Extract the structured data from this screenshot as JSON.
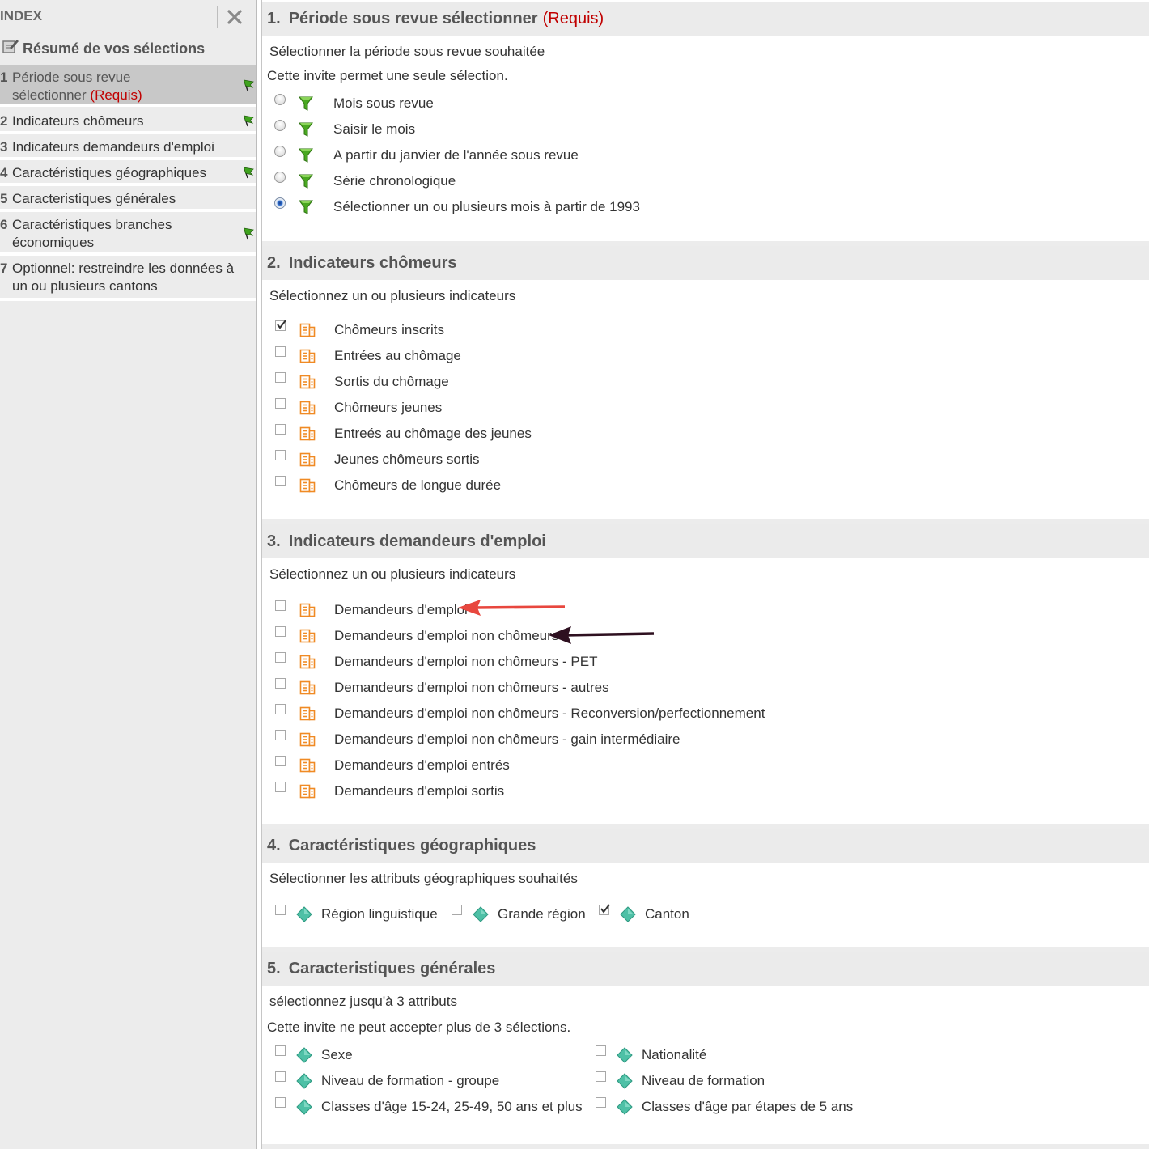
{
  "sidebar": {
    "title": "INDEX",
    "summary_label": "Résumé de vos sélections",
    "items": [
      {
        "num": "1",
        "line1": "Période sous revue",
        "line2": "sélectionner",
        "required": "(Requis)"
      },
      {
        "num": "2",
        "label": "Indicateurs chômeurs"
      },
      {
        "num": "3",
        "label": "Indicateurs demandeurs d'emploi"
      },
      {
        "num": "4",
        "label": "Caractéristiques géographiques"
      },
      {
        "num": "5",
        "label": "Caracteristiques générales"
      },
      {
        "num": "6",
        "line1": "Caractéristiques branches",
        "line2": "économiques"
      },
      {
        "num": "7",
        "line1": "Optionnel: restreindre les données à",
        "line2": "un ou plusieurs cantons"
      }
    ]
  },
  "sections": {
    "s1": {
      "num": "1.",
      "title": "Période sous revue sélectionner",
      "required": "(Requis)",
      "instruction": "Sélectionner la période sous revue souhaitée",
      "note": "Cette invite permet une seule sélection.",
      "options": [
        {
          "label": "Mois sous revue",
          "checked": false
        },
        {
          "label": "Saisir le mois",
          "checked": false
        },
        {
          "label": "A partir du janvier de l'année sous revue",
          "checked": false
        },
        {
          "label": "Série chronologique",
          "checked": false
        },
        {
          "label": "Sélectionner un ou plusieurs mois à partir de 1993",
          "checked": true
        }
      ]
    },
    "s2": {
      "num": "2.",
      "title": "Indicateurs chômeurs",
      "instruction": "Sélectionnez un ou plusieurs indicateurs",
      "options": [
        {
          "label": "Chômeurs inscrits",
          "checked": true
        },
        {
          "label": "Entrées au chômage",
          "checked": false
        },
        {
          "label": "Sortis du chômage",
          "checked": false
        },
        {
          "label": "Chômeurs jeunes",
          "checked": false
        },
        {
          "label": "Entreés au chômage des jeunes",
          "checked": false
        },
        {
          "label": "Jeunes chômeurs sortis",
          "checked": false
        },
        {
          "label": "Chômeurs de longue durée",
          "checked": false
        }
      ]
    },
    "s3": {
      "num": "3.",
      "title": "Indicateurs demandeurs d'emploi",
      "instruction": "Sélectionnez un ou plusieurs indicateurs",
      "options": [
        {
          "label": "Demandeurs d'emploi",
          "checked": false
        },
        {
          "label": "Demandeurs d'emploi non chômeurs",
          "checked": false
        },
        {
          "label": "Demandeurs d'emploi non chômeurs - PET",
          "checked": false
        },
        {
          "label": "Demandeurs d'emploi non chômeurs - autres",
          "checked": false
        },
        {
          "label": "Demandeurs d'emploi non chômeurs - Reconversion/perfectionnement",
          "checked": false
        },
        {
          "label": "Demandeurs d'emploi non chômeurs - gain intermédiaire",
          "checked": false
        },
        {
          "label": "Demandeurs d'emploi entrés",
          "checked": false
        },
        {
          "label": "Demandeurs d'emploi sortis",
          "checked": false
        }
      ]
    },
    "s4": {
      "num": "4.",
      "title": "Caractéristiques géographiques",
      "instruction": "Sélectionner les attributs géographiques souhaités",
      "options": [
        {
          "label": "Région linguistique",
          "checked": false
        },
        {
          "label": "Grande région",
          "checked": false
        },
        {
          "label": "Canton",
          "checked": true
        }
      ]
    },
    "s5": {
      "num": "5.",
      "title": "Caracteristiques générales",
      "instruction": "sélectionnez jusqu'à 3 attributs",
      "note": "Cette invite ne peut accepter plus de 3 sélections.",
      "options": [
        {
          "label": "Sexe",
          "checked": false
        },
        {
          "label": "Nationalité",
          "checked": false
        },
        {
          "label": "Niveau de formation - groupe",
          "checked": false
        },
        {
          "label": "Niveau de formation",
          "checked": false
        },
        {
          "label": "Classes d'âge 15-24, 25-49, 50 ans et plus",
          "checked": false
        },
        {
          "label": "Classes d'âge par étapes de 5 ans",
          "checked": false
        }
      ]
    }
  },
  "colors": {
    "required": "#c00000",
    "filter_icon": "#3f9b1c",
    "metric_icon": "#f08a24",
    "attribute_icon": "#4ec0a6",
    "arrow_red": "#e8473e",
    "arrow_dark": "#2e1020"
  },
  "icons": {
    "filter": "funnel-filter-icon",
    "metric": "metric-report-icon",
    "attribute": "diamond-attribute-icon",
    "flag": "green-flag-icon",
    "close": "close-x-icon",
    "summary": "edit-summary-icon"
  }
}
